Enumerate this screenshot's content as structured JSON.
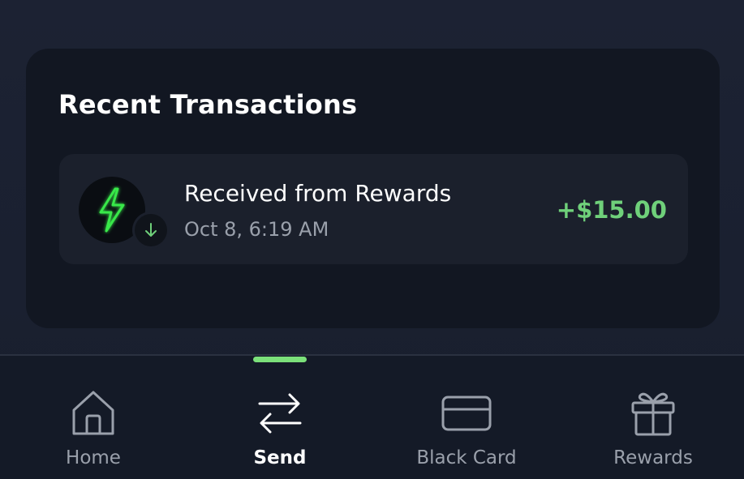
{
  "recent_transactions": {
    "title": "Recent Transactions",
    "items": [
      {
        "title": "Received from Rewards",
        "date": "Oct 8, 6:19 AM",
        "amount": "+$15.00",
        "icon": "lightning-bolt-icon",
        "badge_icon": "arrow-down-icon"
      }
    ]
  },
  "nav": {
    "active": "Send",
    "items": [
      {
        "label": "Home",
        "icon": "home-icon"
      },
      {
        "label": "Send",
        "icon": "transfer-arrows-icon"
      },
      {
        "label": "Black Card",
        "icon": "card-icon"
      },
      {
        "label": "Rewards",
        "icon": "gift-icon"
      }
    ]
  },
  "colors": {
    "accent": "#7be07a",
    "amount_positive": "#6fd07a",
    "background": "#1a2030",
    "card": "#121722"
  }
}
